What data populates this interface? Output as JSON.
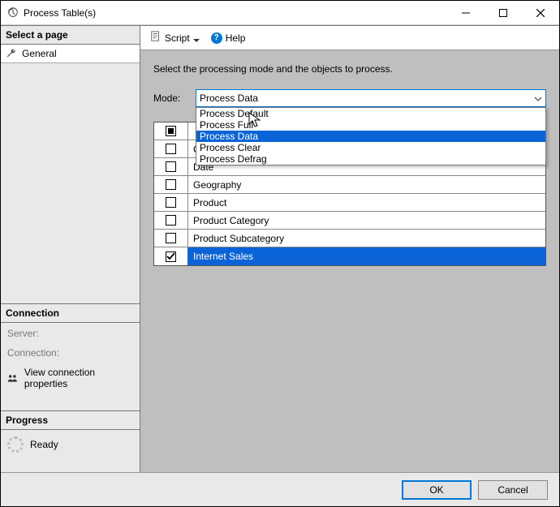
{
  "window": {
    "title": "Process Table(s)"
  },
  "sidebar": {
    "select_page_header": "Select a page",
    "general_label": "General",
    "connection_header": "Connection",
    "server_label": "Server:",
    "connection_label": "Connection:",
    "view_connection_label": "View connection properties",
    "progress_header": "Progress",
    "ready_label": "Ready"
  },
  "toolbar": {
    "script_label": "Script",
    "help_label": "Help"
  },
  "content": {
    "instruction": "Select the processing mode and the objects to process.",
    "mode_label": "Mode:",
    "mode_selected": "Process Data",
    "mode_options": {
      "0": "Process Default",
      "1": "Process Full",
      "2": "Process Data",
      "3": "Process Clear",
      "4": "Process Defrag"
    },
    "rows": {
      "0": {
        "name": "Customer",
        "checked": false
      },
      "1": {
        "name": "Date",
        "checked": false
      },
      "2": {
        "name": "Geography",
        "checked": false
      },
      "3": {
        "name": "Product",
        "checked": false
      },
      "4": {
        "name": "Product Category",
        "checked": false
      },
      "5": {
        "name": "Product Subcategory",
        "checked": false
      },
      "6": {
        "name": "Internet Sales",
        "checked": true
      }
    }
  },
  "footer": {
    "ok_label": "OK",
    "cancel_label": "Cancel"
  }
}
